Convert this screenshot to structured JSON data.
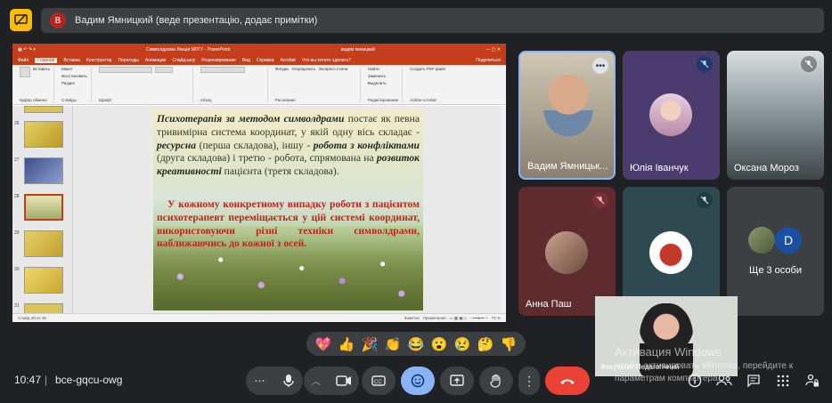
{
  "presentation_bar": {
    "avatar_letter": "В",
    "text": "Вадим Ямницкий (веде презентацію, додає примітки)"
  },
  "ppt": {
    "window_title": "Символдрама Лекція МПГУ  -  PowerPoint",
    "user_name": "вадим ямницкий",
    "tabs": [
      "Файл",
      "Главная",
      "Вставка",
      "Конструктор",
      "Переходы",
      "Анимация",
      "Слайд-шоу",
      "Рецензирование",
      "Вид",
      "Справка",
      "Acrobat",
      "Что вы хотите сделать?"
    ],
    "active_tab": "Главная",
    "share_label": "Поделиться",
    "ribbon_groups": [
      {
        "name": "Буфер обмена",
        "items": [
          "Вставить",
          "Макет",
          "Восстановить",
          "Раздел"
        ]
      },
      {
        "name": "Слайды",
        "items": [
          "Создать слайд"
        ]
      },
      {
        "name": "Шрифт",
        "items": []
      },
      {
        "name": "Абзац",
        "items": []
      },
      {
        "name": "Рисование",
        "items": [
          "Фигуры",
          "Упорядочить",
          "Экспресс-стили"
        ]
      },
      {
        "name": "Редактирование",
        "items": [
          "Найти",
          "Заменить",
          "Выделить"
        ]
      },
      {
        "name": "Adobe Acrobat",
        "items": [
          "Создать PDF-файл"
        ]
      }
    ],
    "thumbnails": [
      {
        "num": "26"
      },
      {
        "num": "27"
      },
      {
        "num": "28"
      },
      {
        "num": "29"
      },
      {
        "num": "30"
      },
      {
        "num": "31"
      }
    ],
    "status_left": "Слайд 28 из 36",
    "status_notes": "Заметки",
    "status_comments": "Примечания",
    "status_zoom": "73 %"
  },
  "slide": {
    "p1_b1": "Психотерапія за методом символдрами",
    "p1_t1": " постає як певна тривимірна система координат, у якій одну вісь складає - ",
    "p1_b2": "ресурсна",
    "p1_t2": " (перша складова), іншу - ",
    "p1_b3": "робота з конфліктами",
    "p1_t3": " (друга складова) і третю - робота, спрямована на ",
    "p1_b4": "розвиток креативності",
    "p1_t4": " пацієнта (третя складова).",
    "p2": "У кожному конкретному випадку роботи з пацієнтом психотерапевт переміщається у цій системі координат, використовуючи різні техніки символдрами, наближаючись до кожної з осей."
  },
  "participants": [
    {
      "name": "Вадим Ямницьк...",
      "state": "speaking"
    },
    {
      "name": "Юлія Іванчук",
      "state": "muted"
    },
    {
      "name": "Оксана Мороз",
      "state": "muted"
    },
    {
      "name": "Анна Паш",
      "state": "muted"
    },
    {
      "name": "",
      "state": "muted"
    },
    {
      "name": "Ще 3 особи",
      "avatar_letter": "D"
    }
  ],
  "self_view": {
    "name": "Факультет Педагогічний"
  },
  "reactions": [
    "💖",
    "👍",
    "🎉",
    "👏",
    "😂",
    "😮",
    "😢",
    "🤔",
    "👎"
  ],
  "watermark": {
    "title": "Активация Windows",
    "text": "Чтобы активировать Windows, перейдите к параметрам компьютера."
  },
  "bottom_bar": {
    "time": "10:47",
    "separator": "|",
    "meeting_code": "bce-gqcu-owg"
  },
  "colors": {
    "background": "#202124",
    "tile": "#3c4043",
    "accent": "#8ab4f8",
    "end_call": "#ea4335",
    "present_icon": "#fbbc04",
    "ppt_brand": "#c43e1c"
  }
}
